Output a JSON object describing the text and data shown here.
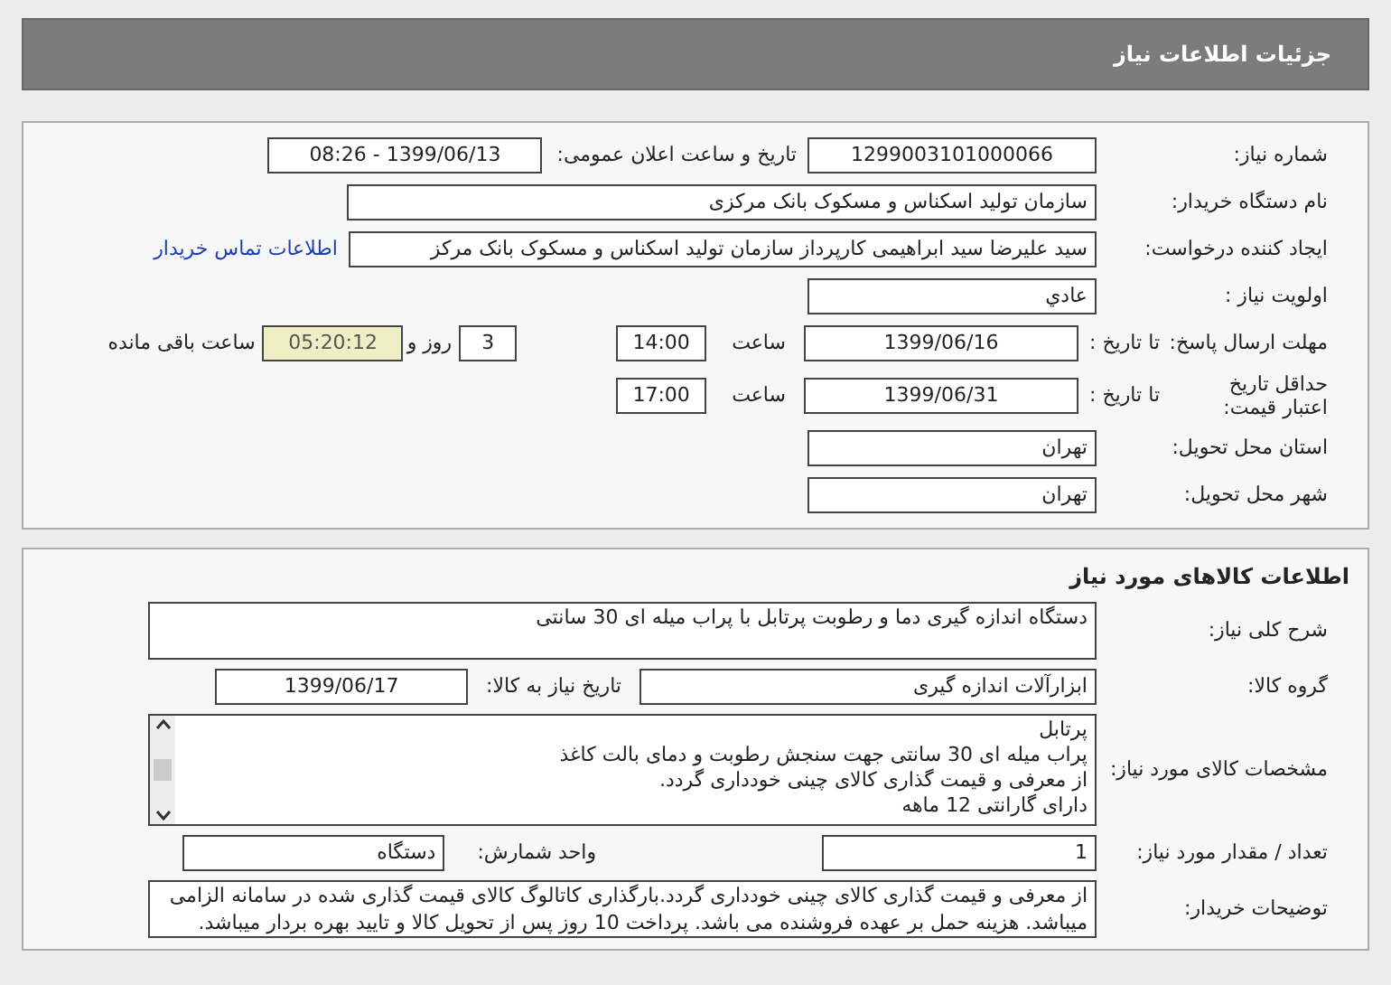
{
  "header": {
    "title": "جزئیات اطلاعات نیاز"
  },
  "need_info": {
    "need_number": {
      "label": "شماره نیاز:",
      "value": "1299003101000066"
    },
    "announce_date": {
      "label": "تاریخ و ساعت اعلان عمومی:",
      "value": "1399/06/13 - 08:26"
    },
    "buyer_org": {
      "label": "نام دستگاه خریدار:",
      "value": "سازمان تولید اسکناس و مسکوک بانک مرکزی"
    },
    "requester": {
      "label": "ایجاد کننده درخواست:",
      "value": "سید علیرضا سید ابراهیمی کارپرداز سازمان تولید اسکناس و مسکوک بانک مرکز",
      "link": "اطلاعات تماس خریدار"
    },
    "priority": {
      "label": "اولویت نیاز :",
      "value": "عادي"
    },
    "response_deadline": {
      "label": "مهلت ارسال پاسخ:",
      "date_label": "تا تاریخ :",
      "date": "1399/06/16",
      "time_label": "ساعت",
      "time": "14:00",
      "days": "3",
      "days_label": "روز و",
      "remaining": "05:20:12",
      "remaining_label": "ساعت باقی مانده"
    },
    "price_validity": {
      "label": "حداقل تاریخ اعتبار قیمت:",
      "date_label": "تا تاریخ :",
      "date": "1399/06/31",
      "time_label": "ساعت",
      "time": "17:00"
    },
    "province": {
      "label": "استان محل تحویل:",
      "value": "تهران"
    },
    "city": {
      "label": "شهر محل تحویل:",
      "value": "تهران"
    }
  },
  "goods_info": {
    "title": "اطلاعات کالاهای مورد نیاز",
    "description": {
      "label": "شرح کلی نیاز:",
      "value": "دستگاه اندازه گیری دما و رطوبت پرتابل با پراب میله ای 30 سانتی"
    },
    "group": {
      "label": "گروه کالا:",
      "value": "ابزارآلات اندازه گیری"
    },
    "need_date": {
      "label": "تاریخ نیاز به کالا:",
      "value": "1399/06/17"
    },
    "specs": {
      "label": "مشخصات کالای مورد نیاز:",
      "lines": [
        "پرتابل",
        "پراب میله ای 30 سانتی جهت سنجش رطوبت و دمای بالت کاغذ",
        "از معرفی و قیمت گذاری کالای چینی خودداری گردد.",
        "دارای گارانتی 12 ماهه"
      ]
    },
    "quantity": {
      "label": "تعداد / مقدار مورد نیاز:",
      "value": "1"
    },
    "unit": {
      "label": "واحد شمارش:",
      "value": "دستگاه"
    },
    "buyer_notes": {
      "label": "توضیحات خریدار:",
      "value": "از معرفی و قیمت گذاری کالای چینی خودداری گردد.بارگذاری کاتالوگ کالای قیمت گذاری شده در سامانه الزامی میباشد. هزینه حمل بر عهده فروشنده می باشد. پرداخت 10 روز پس از تحویل کالا و تایید بهره بردار میباشد."
    }
  }
}
